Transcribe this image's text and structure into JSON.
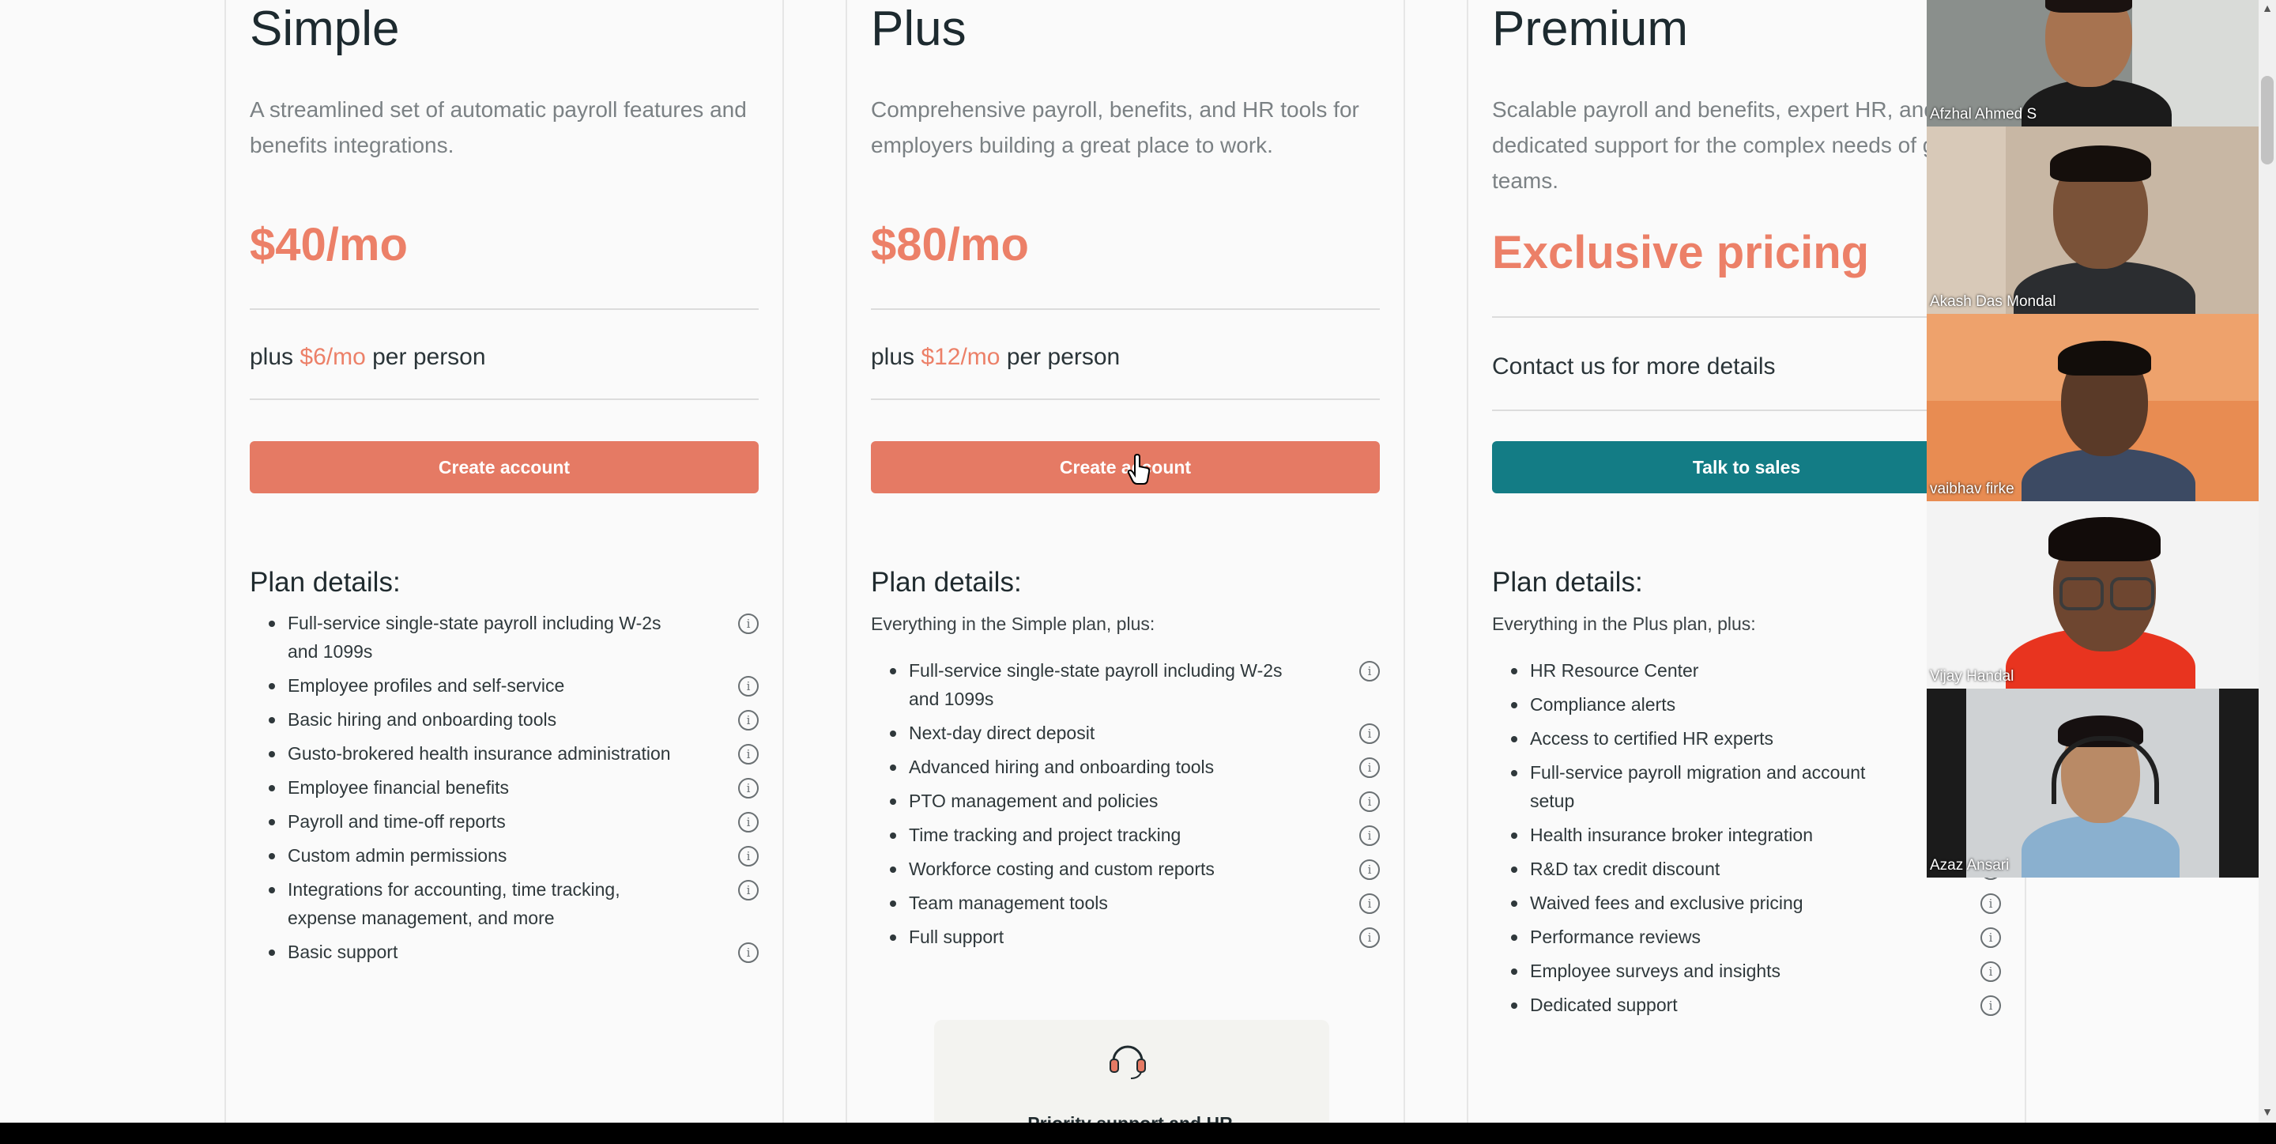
{
  "plans": [
    {
      "name": "Simple",
      "description": "A streamlined set of automatic payroll features and benefits integrations.",
      "price": "$40/mo",
      "per_prefix": "plus",
      "per_amount": "$6/mo",
      "per_suffix": "per person",
      "button": "Create account",
      "details_title": "Plan details:",
      "features": [
        "Full-service single-state payroll including W-2s and 1099s",
        "Employee profiles and self-service",
        "Basic hiring and onboarding tools",
        "Gusto-brokered health insurance administration",
        "Employee financial benefits",
        "Payroll and time-off reports",
        "Custom admin permissions",
        "Integrations for accounting, time tracking, expense management, and more",
        "Basic support"
      ]
    },
    {
      "name": "Plus",
      "description": "Comprehensive payroll, benefits, and HR tools for employers building a great place to work.",
      "price": "$80/mo",
      "per_prefix": "plus",
      "per_amount": "$12/mo",
      "per_suffix": "per person",
      "button": "Create account",
      "details_title": "Plan details:",
      "intro": "Everything in the Simple plan, plus:",
      "features": [
        "Full-service single-state payroll including W-2s and 1099s",
        "Next-day direct deposit",
        "Advanced hiring and onboarding tools",
        "PTO management and policies",
        "Time tracking and project tracking",
        "Workforce costing and custom reports",
        "Team management tools",
        "Full support"
      ]
    },
    {
      "name": "Premium",
      "description": "Scalable payroll and benefits, expert HR, and dedicated support for the complex needs of growing teams.",
      "price": "Exclusive pricing",
      "contact": "Contact us for more details",
      "button": "Talk to sales",
      "details_title": "Plan details:",
      "intro": "Everything in the Plus plan, plus:",
      "features": [
        "HR Resource Center",
        "Compliance alerts",
        "Access to certified HR experts",
        "Full-service payroll migration and account setup",
        "Health insurance broker integration",
        "R&D tax credit discount",
        "Waived fees and exclusive pricing",
        "Performance reviews",
        "Employee surveys and insights",
        "Dedicated support"
      ]
    }
  ],
  "support_card": {
    "title": "Priority support and HR"
  },
  "participants": [
    "Afzhal Ahmed S",
    "Akash Das Mondal",
    "vaibhav firke",
    "Vijay Handal",
    "Azaz Ansari"
  ],
  "colors": {
    "accent": "#e57a64",
    "teal": "#137c85",
    "text": "#1f2a2e"
  }
}
